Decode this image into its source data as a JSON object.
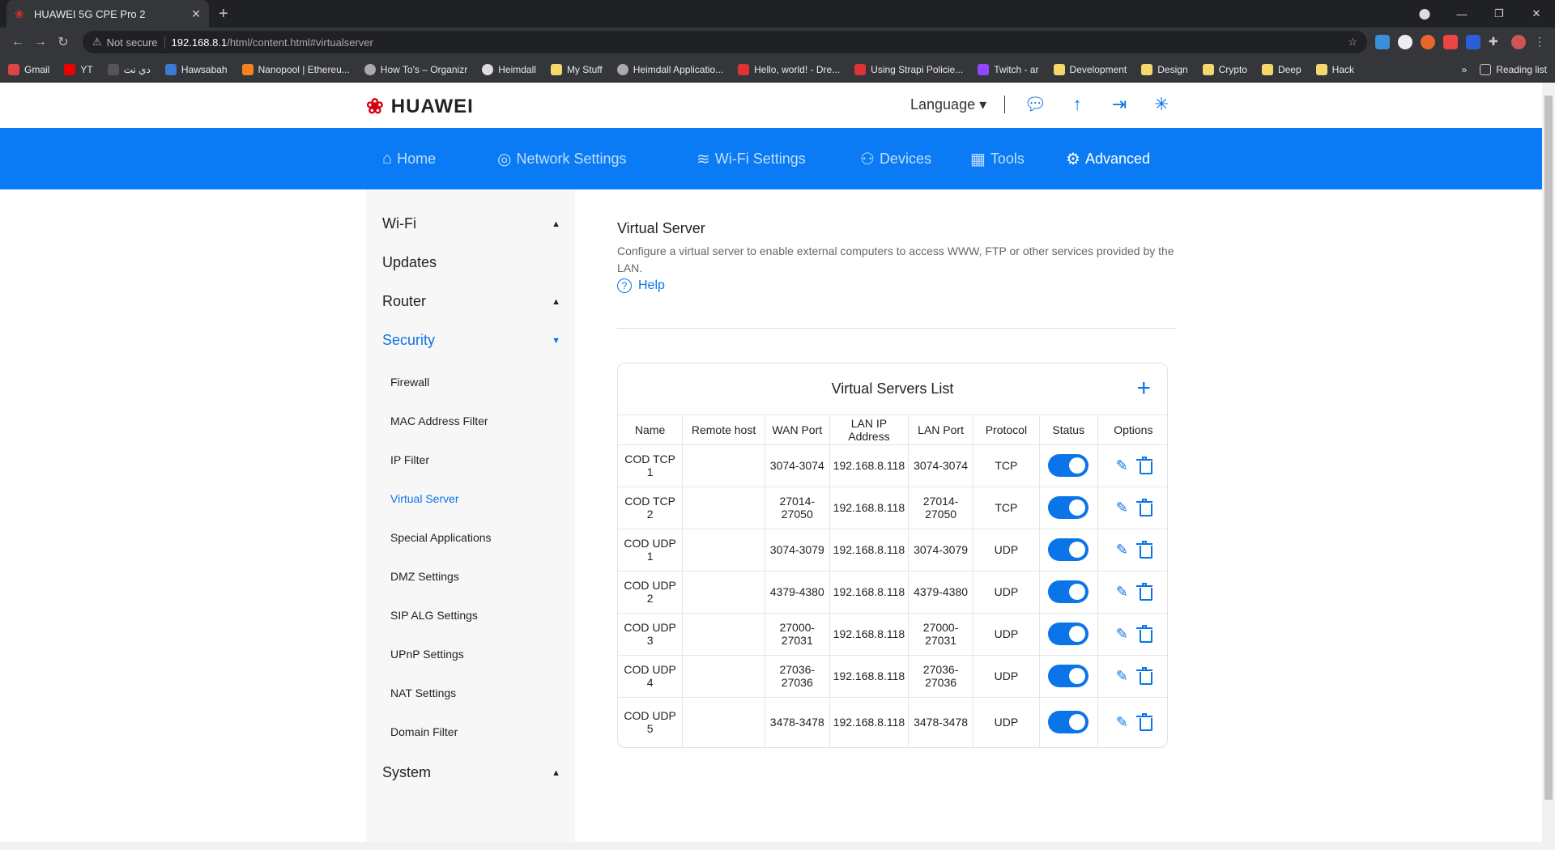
{
  "browser": {
    "tab_title": "HUAWEI 5G CPE Pro 2",
    "new_tab": "+",
    "url_not_secure": "Not secure",
    "url_host": "192.168.8.1",
    "url_path": "/html/content.html#virtualserver",
    "bookmarks": [
      "Gmail",
      "YT",
      "دي نت",
      "Hawsabah",
      "Nanopool | Ethereu...",
      "How To's – Organizr",
      "Heimdall",
      "My Stuff",
      "Heimdall Applicatio...",
      "Hello, world! - Dre...",
      "Using Strapi Policie...",
      "Twitch - ar",
      "Development",
      "Design",
      "Crypto",
      "Deep",
      "Hack"
    ],
    "bookmarks_more": "»",
    "reading_list": "Reading list"
  },
  "header": {
    "brand": "HUAWEI",
    "language": "Language ▾"
  },
  "nav": {
    "home": "Home",
    "network": "Network Settings",
    "wifi": "Wi-Fi Settings",
    "devices": "Devices",
    "tools": "Tools",
    "advanced": "Advanced"
  },
  "sidebar": {
    "groups": [
      "Wi-Fi",
      "Updates",
      "Router",
      "Security",
      "System"
    ],
    "security_items": [
      "Firewall",
      "MAC Address Filter",
      "IP Filter",
      "Virtual Server",
      "Special Applications",
      "DMZ Settings",
      "SIP ALG Settings",
      "UPnP Settings",
      "NAT Settings",
      "Domain Filter"
    ]
  },
  "main": {
    "title": "Virtual Server",
    "description": "Configure a virtual server to enable external computers to access WWW, FTP or other services provided by the LAN.",
    "help": "Help",
    "list_title": "Virtual Servers List",
    "columns": [
      "Name",
      "Remote host",
      "WAN Port",
      "LAN IP Address",
      "LAN Port",
      "Protocol",
      "Status",
      "Options"
    ],
    "rows": [
      {
        "name": "COD TCP 1",
        "remote": "",
        "wan": "3074-3074",
        "lanip": "192.168.8.118",
        "lanport": "3074-3074",
        "protocol": "TCP",
        "status": "on"
      },
      {
        "name": "COD TCP 2",
        "remote": "",
        "wan": "27014-27050",
        "lanip": "192.168.8.118",
        "lanport": "27014-27050",
        "protocol": "TCP",
        "status": "on"
      },
      {
        "name": "COD UDP 1",
        "remote": "",
        "wan": "3074-3079",
        "lanip": "192.168.8.118",
        "lanport": "3074-3079",
        "protocol": "UDP",
        "status": "on"
      },
      {
        "name": "COD UDP 2",
        "remote": "",
        "wan": "4379-4380",
        "lanip": "192.168.8.118",
        "lanport": "4379-4380",
        "protocol": "UDP",
        "status": "on"
      },
      {
        "name": "COD UDP 3",
        "remote": "",
        "wan": "27000-27031",
        "lanip": "192.168.8.118",
        "lanport": "27000-27031",
        "protocol": "UDP",
        "status": "on"
      },
      {
        "name": "COD UDP 4",
        "remote": "",
        "wan": "27036-27036",
        "lanip": "192.168.8.118",
        "lanport": "27036-27036",
        "protocol": "UDP",
        "status": "on"
      },
      {
        "name": "COD UDP 5",
        "remote": "",
        "wan": "3478-3478",
        "lanip": "192.168.8.118",
        "lanport": "3478-3478",
        "protocol": "UDP",
        "status": "on"
      }
    ]
  },
  "colors": {
    "accent": "#0a7bf5",
    "brand_red": "#d7000f",
    "sidebar_bg": "#f7f7f7"
  }
}
